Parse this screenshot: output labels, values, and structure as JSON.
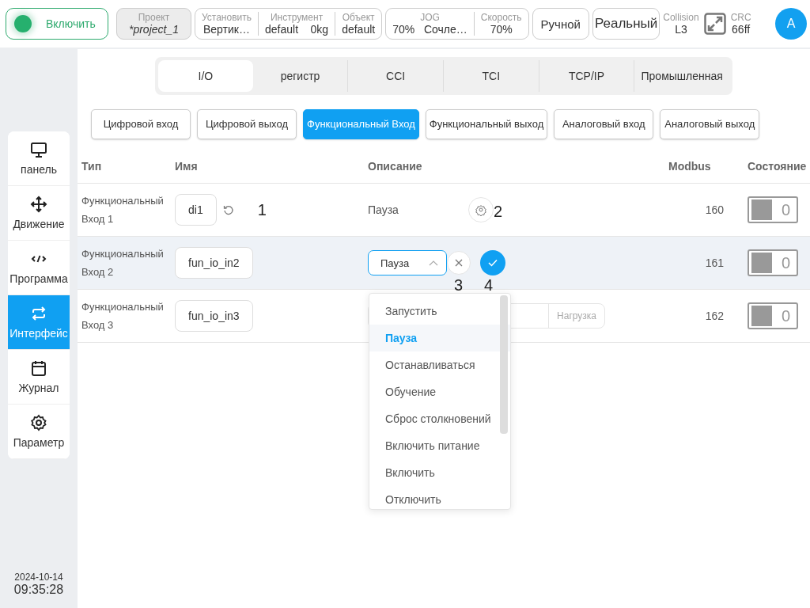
{
  "top_bar": {
    "power": {
      "label": "Включить",
      "on": true
    },
    "project": {
      "label": "Проект",
      "value": "*project_1"
    },
    "setup_group": [
      {
        "label": "Установить",
        "value": "Вертик…"
      },
      {
        "label": "Инструмент",
        "value": "default    0kg"
      },
      {
        "label": "Объект",
        "value": "default"
      }
    ],
    "motion_group": [
      {
        "label": "JOG",
        "value": "70%   Сочле…"
      },
      {
        "label": "Скорость",
        "value": "70%"
      }
    ],
    "mode_buttons": [
      "Ручной",
      "Реальный"
    ],
    "collision": {
      "label": "Collision",
      "value": "L3"
    },
    "crc": {
      "label": "CRC",
      "value": "66ff"
    },
    "avatar": "A"
  },
  "sidebar": {
    "items": [
      {
        "label": "панель",
        "selected": false
      },
      {
        "label": "Движение",
        "selected": false
      },
      {
        "label": "Программа",
        "selected": false
      },
      {
        "label": "Интерфейс",
        "selected": true
      },
      {
        "label": "Журнал",
        "selected": false
      },
      {
        "label": "Параметр",
        "selected": false
      }
    ],
    "date": "2024-10-14",
    "time": "09:35:28"
  },
  "tabs": [
    {
      "label": "I/O",
      "selected": true
    },
    {
      "label": "регистр",
      "selected": false
    },
    {
      "label": "CCI",
      "selected": false
    },
    {
      "label": "TCI",
      "selected": false
    },
    {
      "label": "TCP/IP",
      "selected": false
    },
    {
      "label": "Промышленная",
      "selected": false
    }
  ],
  "subtabs": [
    {
      "label": "Цифровой вход",
      "selected": false
    },
    {
      "label": "Цифровой выход",
      "selected": false
    },
    {
      "label": "Функциональный Вход",
      "selected": true
    },
    {
      "label": "Функциональный выход",
      "selected": false
    },
    {
      "label": "Аналоговый вход",
      "selected": false
    },
    {
      "label": "Аналоговый выход",
      "selected": false
    }
  ],
  "table": {
    "columns": [
      "Тип",
      "Имя",
      "Описание",
      "Modbus",
      "Состояние"
    ],
    "rows": [
      {
        "type": "Функциональный Вход 1",
        "name": "di1",
        "name_reset": true,
        "annotation_name": "1",
        "kind": "text",
        "description": "Пауза",
        "annotation_desc": "2",
        "modbus": "160",
        "state": {
          "on": false,
          "value": "0"
        },
        "selected": false
      },
      {
        "type": "Функциональный Вход 2",
        "name": "fun_io_in2",
        "name_reset": false,
        "kind": "select",
        "description": "Пауза",
        "annotation_cancel": "3",
        "annotation_confirm": "4",
        "modbus": "161",
        "state": {
          "on": false,
          "value": "0"
        },
        "selected": true
      },
      {
        "type": "Функциональный Вход 3",
        "name": "fun_io_in3",
        "name_reset": false,
        "kind": "field",
        "description_suffix": "Нагрузка",
        "modbus": "162",
        "state": {
          "on": false,
          "value": "0"
        },
        "selected": false
      }
    ]
  },
  "dropdown": {
    "options": [
      {
        "label": "Запустить",
        "selected": false
      },
      {
        "label": "Пауза",
        "selected": true
      },
      {
        "label": "Останавливаться",
        "selected": false
      },
      {
        "label": "Обучение",
        "selected": false
      },
      {
        "label": "Сброс столкновений",
        "selected": false
      },
      {
        "label": "Включить питание",
        "selected": false
      },
      {
        "label": "Включить",
        "selected": false
      },
      {
        "label": "Отключить",
        "selected": false
      }
    ]
  }
}
